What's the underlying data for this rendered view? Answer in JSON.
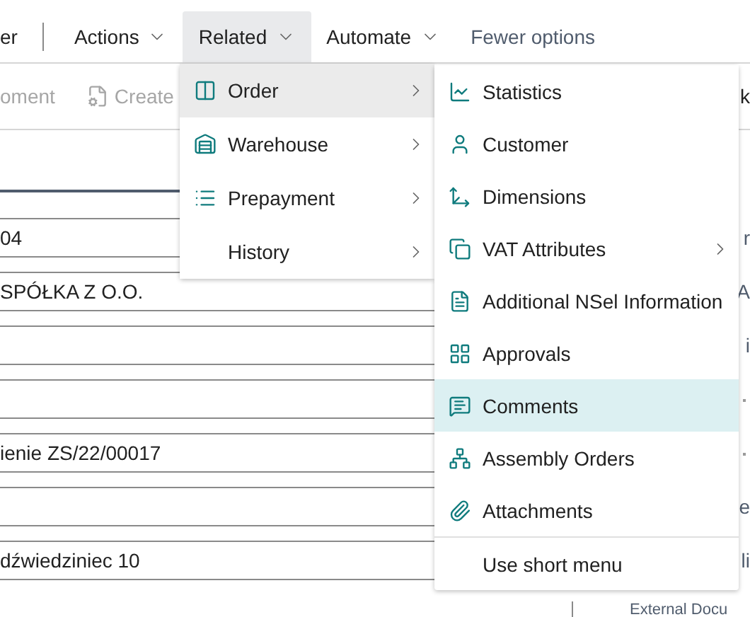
{
  "tabs": [
    {
      "label": "er",
      "selected": false,
      "kind": "plain"
    },
    {
      "label": "Actions",
      "selected": false,
      "kind": "menu"
    },
    {
      "label": "Related",
      "selected": true,
      "kind": "menu"
    },
    {
      "label": "Automate",
      "selected": false,
      "kind": "menu"
    },
    {
      "label": "Fewer options",
      "selected": false,
      "kind": "link"
    }
  ],
  "actions": [
    {
      "label": "oment",
      "disabled": true
    },
    {
      "label": "Create",
      "disabled": true
    }
  ],
  "actions_right": "k",
  "fields": [
    {
      "kind": "filled",
      "value": "04"
    },
    {
      "kind": "filled",
      "value": "SPÓŁKA Z O.O."
    },
    {
      "kind": "empty"
    },
    {
      "kind": "empty"
    },
    {
      "kind": "filled",
      "value": "ienie ZS/22/00017"
    },
    {
      "kind": "empty"
    },
    {
      "kind": "filled",
      "value": "dźwiedziniec 10"
    }
  ],
  "right_rows": [
    {
      "kind": "text",
      "text": "r"
    },
    {
      "kind": "text",
      "text": "A"
    },
    {
      "kind": "text",
      "text": "i"
    },
    {
      "kind": "dot"
    },
    {
      "kind": "dot"
    },
    {
      "kind": "text",
      "text": "e"
    },
    {
      "kind": "text",
      "text": "li"
    }
  ],
  "bottom_label": "External Docu",
  "related_menu": [
    {
      "label": "Order",
      "selected": true
    },
    {
      "label": "Warehouse",
      "selected": false
    },
    {
      "label": "Prepayment",
      "selected": false
    },
    {
      "label": "History",
      "selected": false
    }
  ],
  "order_menu": {
    "items": [
      {
        "label": "Statistics",
        "has_submenu": false,
        "selected": false
      },
      {
        "label": "Customer",
        "has_submenu": false,
        "selected": false
      },
      {
        "label": "Dimensions",
        "has_submenu": false,
        "selected": false
      },
      {
        "label": "VAT Attributes",
        "has_submenu": true,
        "selected": false
      },
      {
        "label": "Additional NSel Information",
        "has_submenu": false,
        "selected": false
      },
      {
        "label": "Approvals",
        "has_submenu": false,
        "selected": false
      },
      {
        "label": "Comments",
        "has_submenu": false,
        "selected": true
      },
      {
        "label": "Assembly Orders",
        "has_submenu": false,
        "selected": false
      },
      {
        "label": "Attachments",
        "has_submenu": false,
        "selected": false
      }
    ],
    "footer": "Use short menu"
  }
}
